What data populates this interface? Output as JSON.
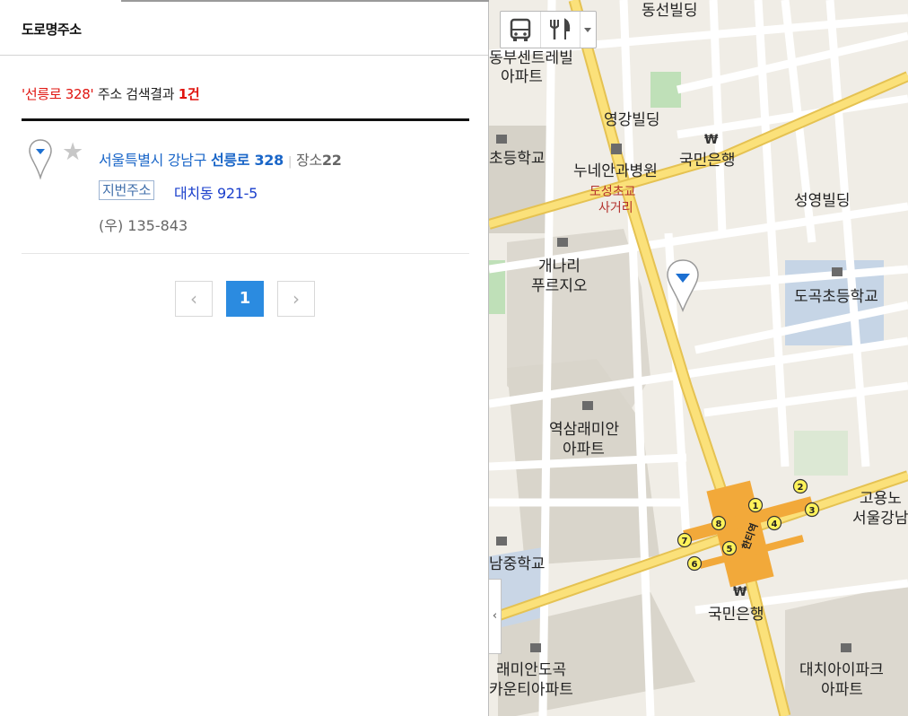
{
  "tab": {
    "title": "도로명주소"
  },
  "search": {
    "query_quoted": "'선릉로 328'",
    "mid": " 주소 검색결과 ",
    "count": "1건"
  },
  "result": {
    "city": "서울특별시 강남구 ",
    "road": "선릉로 328",
    "place_type": "장소",
    "place_count": "22",
    "jibun_badge": "지번주소",
    "jibun_value": "대치동 921-5",
    "postal": "(우) 135-843"
  },
  "pagination": {
    "prev": "‹",
    "current": "1",
    "next": "›"
  },
  "map": {
    "labels": {
      "dongseon": "동선빌딩",
      "center": "동부센트레빌",
      "center2": "아파트",
      "yeonggang": "영강빌딩",
      "elem1": "초등학교",
      "nune": "누네안과병원",
      "kb1": "국민은행",
      "doseong1": "도성초교",
      "doseong2": "사거리",
      "seongyeong": "성영빌딩",
      "gaenari1": "개나리",
      "gaenari2": "푸르지오",
      "dogok": "도곡초등학교",
      "raemian1": "역삼래미안",
      "raemian2": "아파트",
      "goyong1": "고용노",
      "goyong2": "서울강남",
      "middle": "남중학교",
      "kb2": "국민은행",
      "county1": "래미안도곡",
      "county2": "카운티아파트",
      "daechi1": "대치아이파크",
      "daechi2": "아파트",
      "station": "한티역"
    },
    "exits": [
      "1",
      "2",
      "3",
      "4",
      "5",
      "6",
      "7",
      "8"
    ],
    "icons": [
      "bus-icon",
      "food-icon",
      "chevron-down-icon",
      "map-pin-icon"
    ]
  }
}
